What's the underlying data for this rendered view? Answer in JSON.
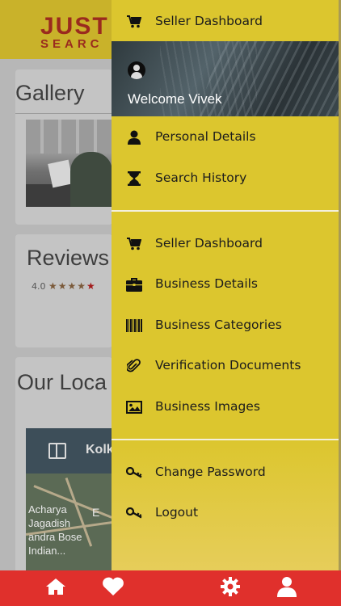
{
  "background": {
    "logo": {
      "line1": "JUST",
      "line2": "SEARC"
    },
    "gallery": {
      "title": "Gallery"
    },
    "reviews": {
      "title": "Reviews",
      "rating": "4.0",
      "stars": "★★★★★"
    },
    "location": {
      "title": "Our Loca",
      "map_label": "Kolk",
      "map_text": "Acharya\nJagadish\nandra Bose\nIndian...",
      "map_text2": "E"
    }
  },
  "drawer": {
    "top_item": {
      "label": "Seller Dashboard",
      "icon": "cart-icon"
    },
    "profile": {
      "welcome": "Welcome Vivek",
      "icon": "user-circle-icon"
    },
    "section1": [
      {
        "label": "Personal Details",
        "icon": "person-icon"
      },
      {
        "label": "Search History",
        "icon": "hourglass-icon"
      }
    ],
    "section2": [
      {
        "label": "Seller Dashboard",
        "icon": "cart-icon"
      },
      {
        "label": "Business Details",
        "icon": "briefcase-icon"
      },
      {
        "label": "Business Categories",
        "icon": "barcode-icon"
      },
      {
        "label": "Verification Documents",
        "icon": "paperclip-icon"
      },
      {
        "label": "Business Images",
        "icon": "image-icon"
      }
    ],
    "section3": [
      {
        "label": "Change Password",
        "icon": "key-icon"
      },
      {
        "label": "Logout",
        "icon": "key-icon"
      }
    ]
  },
  "bottom_bar": {
    "tabs": [
      {
        "name": "home",
        "icon": "home-icon"
      },
      {
        "name": "favorites",
        "icon": "heart-icon"
      },
      {
        "name": "settings",
        "icon": "gear-icon"
      },
      {
        "name": "profile",
        "icon": "user-icon"
      }
    ]
  },
  "colors": {
    "drawer": "#dcc62e",
    "bottom_bar": "#e0302c",
    "text": "#1c1c1c"
  }
}
